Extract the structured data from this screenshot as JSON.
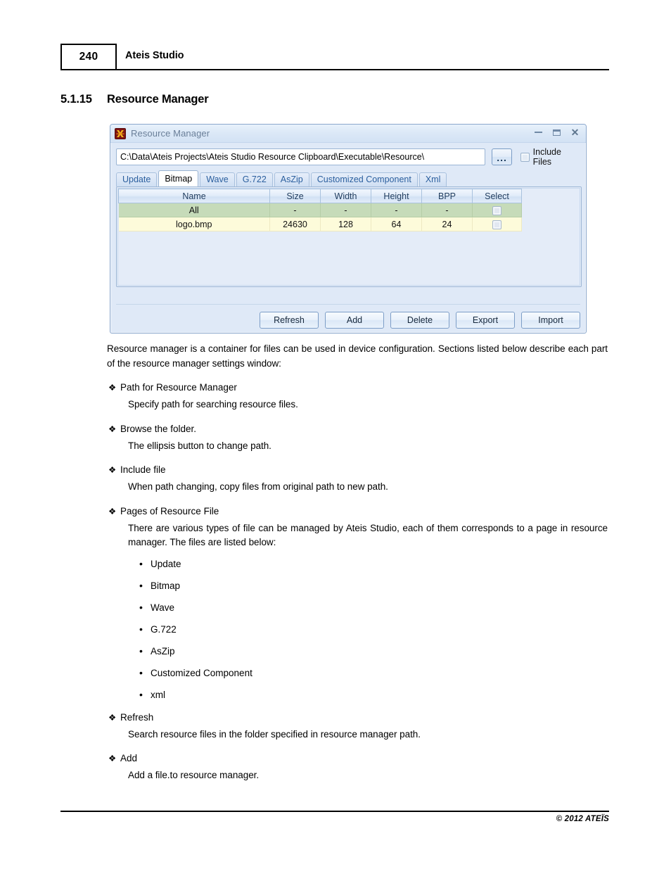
{
  "page": {
    "number": "240",
    "header_title": "Ateis Studio",
    "footer": "© 2012 ATEÏS"
  },
  "section": {
    "number": "5.1.15",
    "title": "Resource Manager"
  },
  "dialog": {
    "title": "Resource Manager",
    "app_icon": "ateis-logo-icon",
    "window_controls": {
      "minimize": "minimize-icon",
      "maximize": "maximize-icon",
      "close": "close-icon"
    },
    "path": {
      "value": "C:\\Data\\Ateis Projects\\Ateis Studio Resource Clipboard\\Executable\\Resource\\",
      "placeholder": ""
    },
    "browse_button_label": "...",
    "include_files": {
      "label": "Include Files",
      "checked": false
    },
    "tabs": [
      {
        "label": "Update",
        "active": false
      },
      {
        "label": "Bitmap",
        "active": true
      },
      {
        "label": "Wave",
        "active": false
      },
      {
        "label": "G.722",
        "active": false
      },
      {
        "label": "AsZip",
        "active": false
      },
      {
        "label": "Customized Component",
        "active": false
      },
      {
        "label": "Xml",
        "active": false
      }
    ],
    "table": {
      "columns": [
        "Name",
        "Size",
        "Width",
        "Height",
        "BPP",
        "Select"
      ],
      "rows": [
        {
          "style": "all",
          "name": "All",
          "size": "-",
          "width": "-",
          "height": "-",
          "bpp": "-",
          "selected": false
        },
        {
          "style": "file",
          "name": "logo.bmp",
          "size": "24630",
          "width": "128",
          "height": "64",
          "bpp": "24",
          "selected": false
        }
      ]
    },
    "buttons": [
      "Refresh",
      "Add",
      "Delete",
      "Export",
      "Import"
    ]
  },
  "body": {
    "intro": "Resource manager is a container for files can be used in device configuration. Sections listed below describe each part of the resource manager settings window:",
    "sections": [
      {
        "heading": "Path for Resource Manager",
        "text": "Specify path for searching resource files."
      },
      {
        "heading": "Browse the folder.",
        "text": "The ellipsis button to change path."
      },
      {
        "heading": "Include file",
        "text": "When path changing, copy files from original path to new path."
      },
      {
        "heading": "Pages of Resource File",
        "text": "There are various types of file can be managed by Ateis Studio, each of them corresponds to a page in resource manager. The files are listed below:"
      },
      {
        "heading": "Refresh",
        "text": "Search resource files in the folder specified in resource manager path."
      },
      {
        "heading": "Add",
        "text": "Add a file.to resource manager."
      }
    ],
    "file_types": [
      "Update",
      "Bitmap",
      "Wave",
      "G.722",
      "AsZip",
      "Customized Component",
      "xml"
    ],
    "bullet_glyph": "❖"
  }
}
